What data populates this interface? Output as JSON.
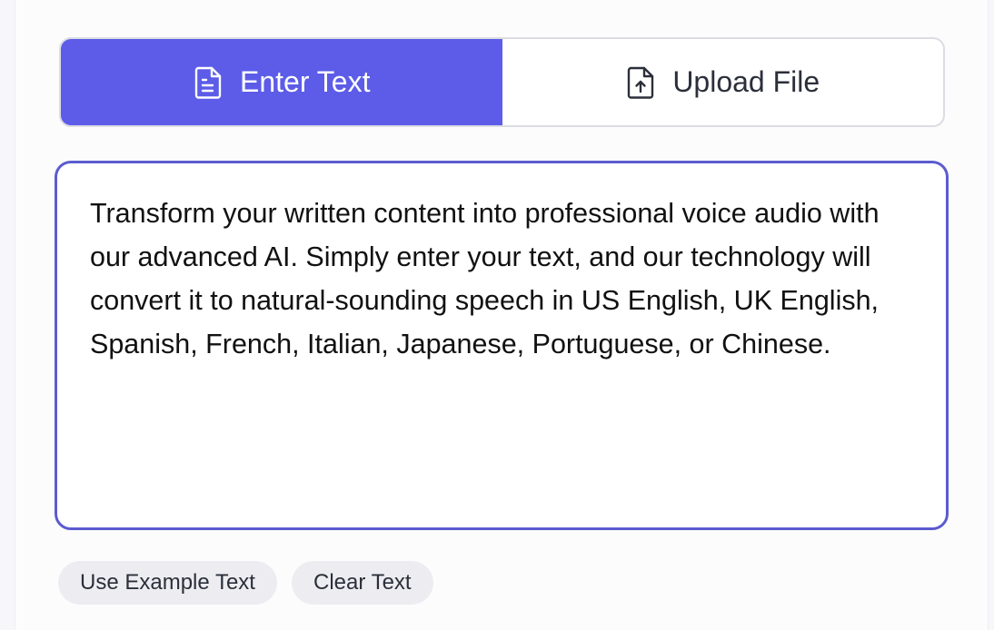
{
  "tabs": [
    {
      "label": "Enter Text",
      "icon": "file-text-icon",
      "active": true
    },
    {
      "label": "Upload File",
      "icon": "file-upload-icon",
      "active": false
    }
  ],
  "editor": {
    "text": "Transform your written content into professional voice audio with our advanced AI. Simply enter your text, and our technology will convert it to natural-sounding speech in US English, UK English, Spanish, French, Italian, Japanese, Portuguese, or Chinese."
  },
  "actions": {
    "example_label": "Use Example Text",
    "clear_label": "Clear Text"
  },
  "colors": {
    "accent": "#5c5ce8",
    "focus_border": "#5b5ccf",
    "pill_bg": "#ededf1"
  }
}
